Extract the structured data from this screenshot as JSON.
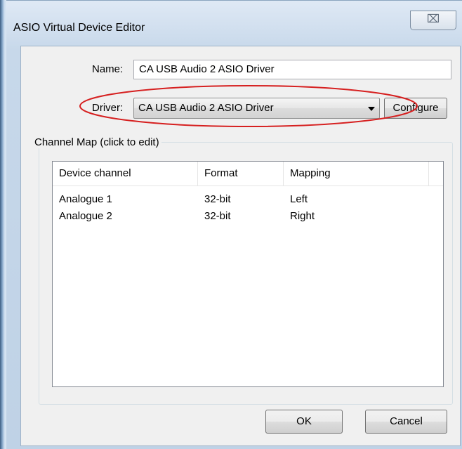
{
  "window": {
    "title": "ASIO Virtual Device Editor",
    "close_glyph": "⌧"
  },
  "form": {
    "name_label": "Name:",
    "name_value": "CA USB Audio 2 ASIO Driver",
    "driver_label": "Driver:",
    "driver_value": "CA USB Audio 2 ASIO Driver",
    "configure_label": "Configure"
  },
  "channel_map": {
    "group_title": "Channel Map (click to edit)",
    "columns": [
      "Device channel",
      "Format",
      "Mapping"
    ],
    "rows": [
      [
        "Analogue 1",
        "32-bit",
        "Left"
      ],
      [
        "Analogue 2",
        "32-bit",
        "Right"
      ]
    ]
  },
  "buttons": {
    "ok_label": "OK",
    "cancel_label": "Cancel"
  },
  "annotation": {
    "color": "#d62020"
  }
}
